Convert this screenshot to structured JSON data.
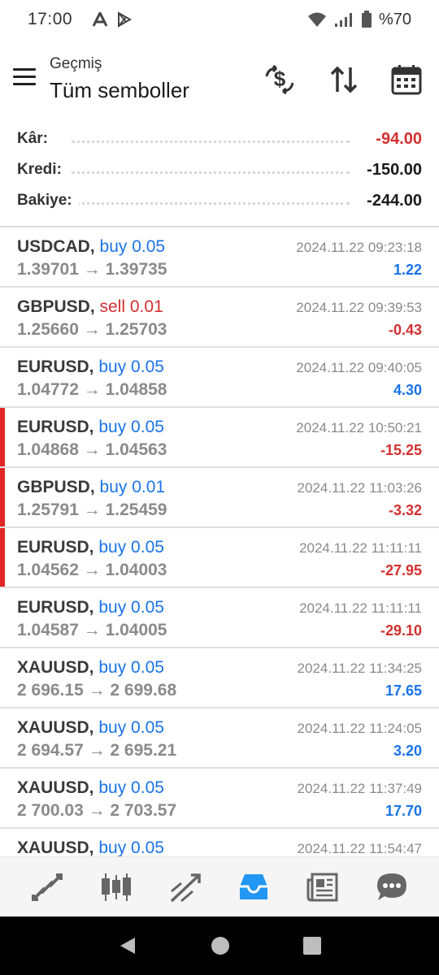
{
  "status_bar": {
    "time": "17:00",
    "battery_text": "%70",
    "icons": [
      "a-letter-icon",
      "play-store-icon",
      "wifi-icon",
      "signal-icon",
      "battery-icon"
    ]
  },
  "header": {
    "subtitle": "Geçmiş",
    "title": "Tüm semboller",
    "actions": [
      "currency-exchange-icon",
      "sort-icon",
      "calendar-icon"
    ]
  },
  "summary": {
    "profit_label": "Kâr:",
    "profit_value": "-94.00",
    "credit_label": "Kredi:",
    "credit_value": "-150.00",
    "balance_label": "Bakiye:",
    "balance_value": "-244.00"
  },
  "trades": [
    {
      "symbol": "USDCAD,",
      "direction": "buy 0.05",
      "prices": "1.39701 → 1.39735",
      "datetime": "2024.11.22 09:23:18",
      "profit": "1.22"
    },
    {
      "symbol": "GBPUSD,",
      "direction": "sell 0.01",
      "prices": "1.25660 → 1.25703",
      "datetime": "2024.11.22 09:39:53",
      "profit": "-0.43"
    },
    {
      "symbol": "EURUSD,",
      "direction": "buy 0.05",
      "prices": "1.04772 → 1.04858",
      "datetime": "2024.11.22 09:40:05",
      "profit": "4.30"
    },
    {
      "symbol": "EURUSD,",
      "direction": "buy 0.05",
      "prices": "1.04868 → 1.04563",
      "datetime": "2024.11.22 10:50:21",
      "profit": "-15.25"
    },
    {
      "symbol": "GBPUSD,",
      "direction": "buy 0.01",
      "prices": "1.25791 → 1.25459",
      "datetime": "2024.11.22 11:03:26",
      "profit": "-3.32"
    },
    {
      "symbol": "EURUSD,",
      "direction": "buy 0.05",
      "prices": "1.04562 → 1.04003",
      "datetime": "2024.11.22 11:11:11",
      "profit": "-27.95"
    },
    {
      "symbol": "EURUSD,",
      "direction": "buy 0.05",
      "prices": "1.04587 → 1.04005",
      "datetime": "2024.11.22 11:11:11",
      "profit": "-29.10"
    },
    {
      "symbol": "XAUUSD,",
      "direction": "buy 0.05",
      "prices": "2 696.15 → 2 699.68",
      "datetime": "2024.11.22 11:34:25",
      "profit": "17.65"
    },
    {
      "symbol": "XAUUSD,",
      "direction": "buy 0.05",
      "prices": "2 694.57 → 2 695.21",
      "datetime": "2024.11.22 11:24:05",
      "profit": "3.20"
    },
    {
      "symbol": "XAUUSD,",
      "direction": "buy 0.05",
      "prices": "2 700.03 → 2 703.57",
      "datetime": "2024.11.22 11:37:49",
      "profit": "17.70"
    },
    {
      "symbol": "XAUUSD,",
      "direction": "buy 0.05",
      "prices": "",
      "datetime": "2024.11.22 11:54:47",
      "profit": ""
    }
  ],
  "bottom_nav": [
    "quotes-arrows-icon",
    "candlestick-chart-icon",
    "trade-trend-icon",
    "history-inbox-icon",
    "news-icon",
    "chat-icon"
  ],
  "active_nav": "history-inbox-icon",
  "colors": {
    "buy": "#1a73e8",
    "sell": "#d32f2f",
    "active": "#2196f3",
    "flag": "#e32626"
  }
}
